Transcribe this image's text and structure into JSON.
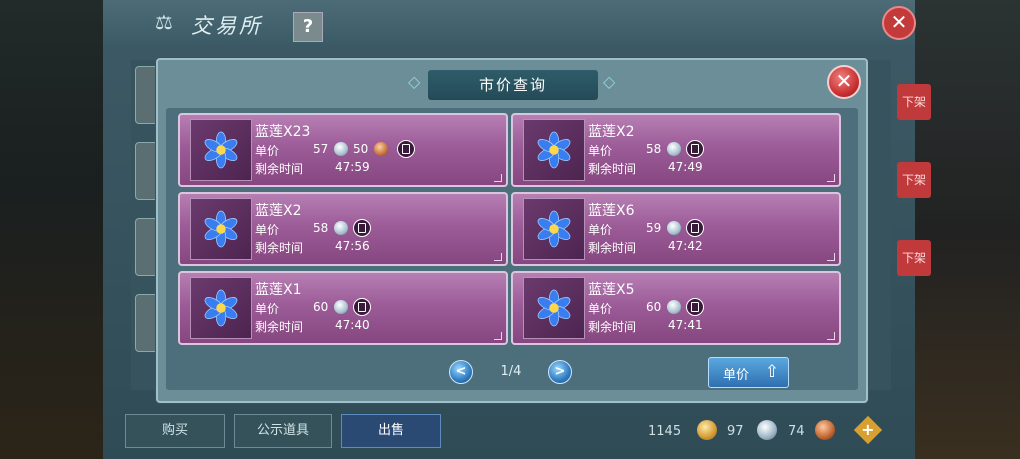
{
  "exchange": {
    "title": "交易所",
    "help_label": "?",
    "close_label": "✕",
    "off_shelf_label": "下架",
    "tabs": [
      {
        "label": "购买"
      },
      {
        "label": "公示道具"
      },
      {
        "label": "出售"
      }
    ],
    "currency": {
      "gold": "1145",
      "silver": "97",
      "copper": "74",
      "add_label": "+"
    }
  },
  "modal": {
    "title": "市价查询",
    "close_label": "✕",
    "price_label": "单价",
    "time_label": "剩余时间",
    "listings": [
      {
        "name": "蓝莲X23",
        "price": "57",
        "price2": "50",
        "time": "47:59"
      },
      {
        "name": "蓝莲X2",
        "price": "58",
        "time": "47:49"
      },
      {
        "name": "蓝莲X2",
        "price": "58",
        "time": "47:56"
      },
      {
        "name": "蓝莲X6",
        "price": "59",
        "time": "47:42"
      },
      {
        "name": "蓝莲X1",
        "price": "60",
        "time": "47:40"
      },
      {
        "name": "蓝莲X5",
        "price": "60",
        "time": "47:41"
      }
    ],
    "pager": {
      "text": "1/4",
      "prev": "<",
      "next": ">"
    },
    "sort_label": "单价"
  }
}
